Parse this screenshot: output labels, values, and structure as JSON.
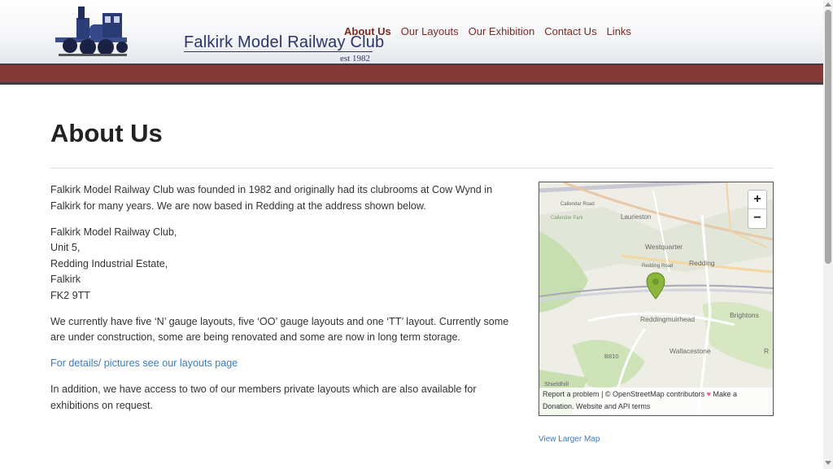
{
  "header": {
    "logo_text": "Falkirk Model Railway Club",
    "logo_est": "est 1982"
  },
  "nav": {
    "items": [
      {
        "label": "About Us"
      },
      {
        "label": "Our Layouts"
      },
      {
        "label": "Our Exhibition"
      },
      {
        "label": "Contact Us"
      },
      {
        "label": "Links"
      }
    ]
  },
  "page": {
    "title": "About Us",
    "intro": "Falkirk Model Railway Club was founded in 1982 and originally had its clubrooms at Cow Wynd in Falkirk for many years. We are now based in Redding at the address shown below.",
    "address": [
      "Falkirk Model Railway Club,",
      "Unit 5,",
      "Redding Industrial Estate,",
      "Falkirk",
      "FK2 9TT"
    ],
    "layouts_text": "We currently have five ‘N’ gauge layouts, five ‘OO’ gauge layouts and one ‘TT’ layout. Currently some are under construction, some are being renovated and some are now in long term storage.",
    "layouts_link": "For details/ pictures see our layouts page",
    "private_text": "In addition, we have access to two of our members private layouts which are also available for exhibitions on request."
  },
  "map": {
    "zoom_in": "+",
    "zoom_out": "−",
    "labels": {
      "laurieston": "Laurieston",
      "westquarter": "Westquarter",
      "redding": "Redding",
      "brightons": "Brightons",
      "reddingmuirhead": "Reddingmuirhead",
      "wallacestone": "Wallacestone",
      "b810": "B810",
      "shieldhill": "Shieldhill",
      "callendar_park": "Callendar Park",
      "callendar_road": "Callendar Road",
      "redding_road": "Redding Road",
      "r": "R"
    },
    "attribution": {
      "report": "Report a problem",
      "sep": "|",
      "osm": "© OpenStreetMap contributors",
      "heart": "♥",
      "donate": "Make a Donation.",
      "api": "Website and API terms"
    },
    "view_larger": "View Larger Map"
  },
  "colors": {
    "nav_text": "#7a2a22",
    "red_bar": "#843a36",
    "link": "#3b7cc0",
    "marker": "#8bb83b"
  }
}
